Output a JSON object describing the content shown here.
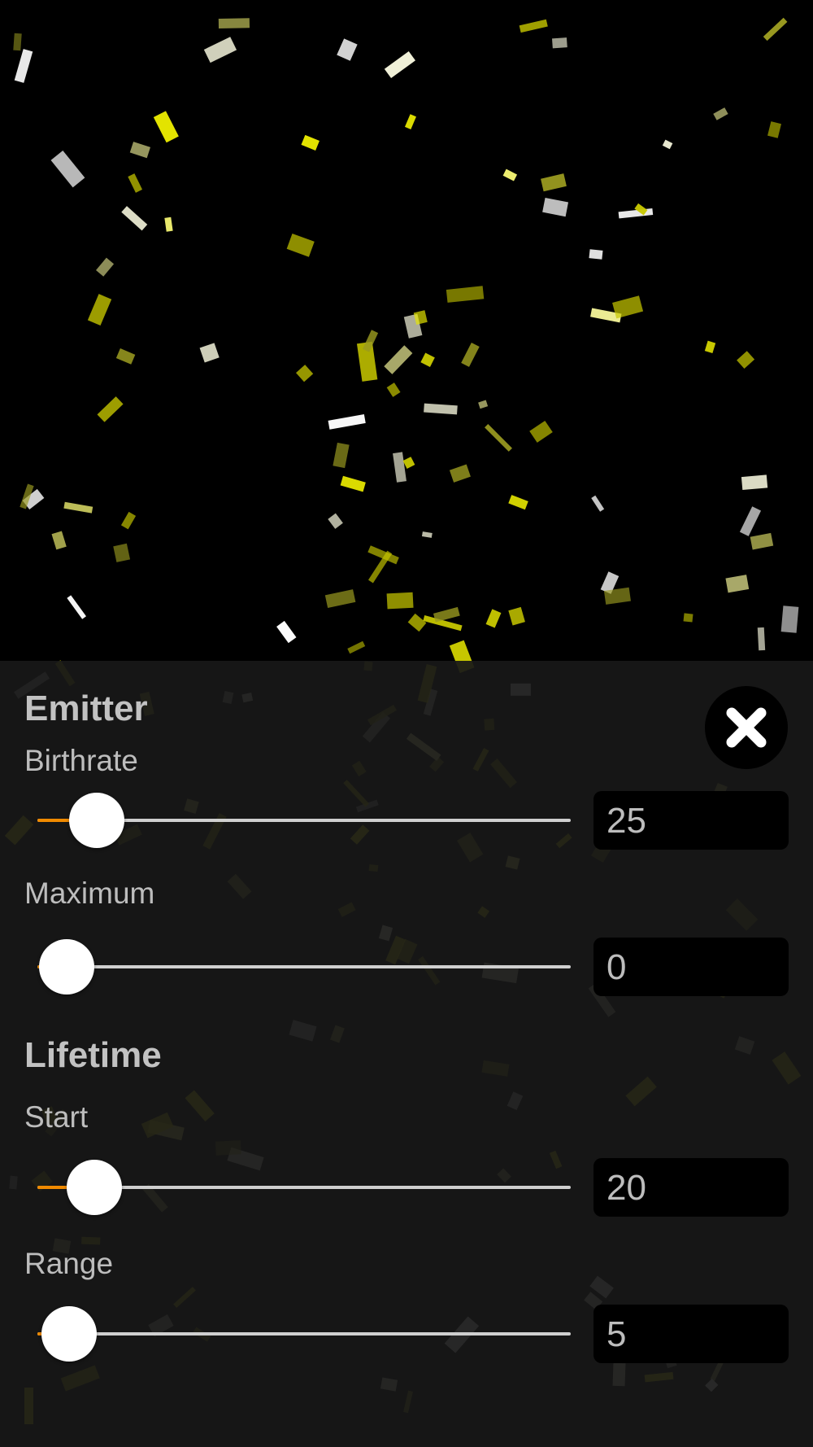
{
  "particle_color": "#e6e600",
  "panel_background": "#181818",
  "emitter": {
    "heading": "Emitter",
    "birthrate": {
      "label": "Birthrate",
      "value": "25",
      "level": 0.06
    },
    "maximum": {
      "label": "Maximum",
      "value": "0",
      "level": 0.0
    }
  },
  "lifetime": {
    "heading": "Lifetime",
    "start": {
      "label": "Start",
      "value": "20",
      "level": 0.055
    },
    "range": {
      "label": "Range",
      "value": "5",
      "level": 0.005
    }
  },
  "close_button": {
    "icon": "close-icon"
  }
}
